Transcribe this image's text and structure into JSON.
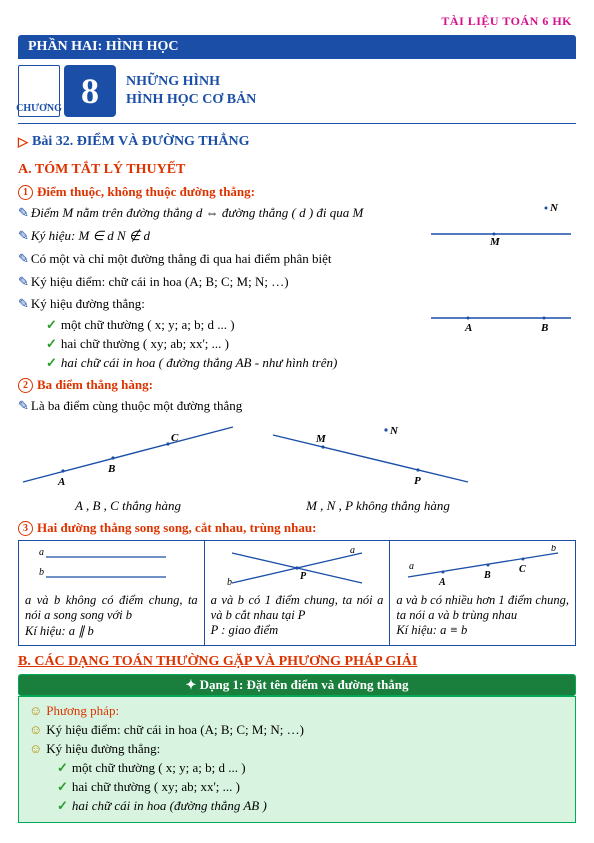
{
  "doc_badge": "TÀI LIỆU TOÁN 6 HK",
  "part_bar": "PHẦN HAI:  HÌNH HỌC",
  "chapter_label": "CHƯƠNG",
  "chapter_num": "8",
  "chapter_line1": "NHỮNG HÌNH",
  "chapter_line2": "HÌNH HỌC CƠ BẢN",
  "lesson_title": "Bài 32. ĐIỂM VÀ ĐƯỜNG THẲNG",
  "sec_a": "A. TÓM TẮT LÝ THUYẾT",
  "sub1_num": "1",
  "sub1_title": "Điểm thuộc, không thuộc đường thẳng:",
  "line1": "Điểm  M  nằm trên đường thẳng d  ⇔   đường thẳng ( d )  đi qua  M",
  "line2": "Ký hiệu:   M ∈ d                         N ∉ d",
  "line3": "Có một và chỉ một đường thẳng đi qua hai điểm phân biệt",
  "line4": "Ký hiệu điểm: chữ cái in hoa (A; B; C; M; N; …)",
  "line5": "Ký hiệu đường thẳng:",
  "chk1": "một chữ thường ( x; y; a; b; d ... )",
  "chk2": "hai chữ thường ( xy; ab; xx'; ... )",
  "chk3": "hai chữ cái in hoa ( đường thẳng  AB  - như hình trên)",
  "sub2_num": "2",
  "sub2_title": "Ba điểm thẳng hàng:",
  "line6": "Là ba điểm cùng thuộc một đường thẳng",
  "cap_left": "A , B , C   thẳng hàng",
  "cap_right": "M , N , P   không thẳng hàng",
  "sub3_num": "3",
  "sub3_title": "Hai đường thẳng song song, cắt nhau, trùng nhau:",
  "col1_t1": "a  và  b  không có điểm chung, ta nói a song song với b",
  "col1_t2": "Kí hiệu:  a ∥ b",
  "col2_t1": "a và b có 1 điểm chung, ta nói a và b cắt nhau tại  P",
  "col2_t2": "P : giao điểm",
  "col3_t1": "a và b có nhiều hơn 1 điểm chung, ta nói a  và  b trùng nhau",
  "col3_t2": "Kí hiệu:  a ≡ b",
  "sec_b": "B. CÁC DẠNG TOÁN THƯỜNG GẶP VÀ PHƯƠNG PHÁP GIẢI",
  "dang_bar": "✦ Dạng 1: Đặt tên điểm và đường thẳng",
  "method_title": "Phương pháp:",
  "m1": "Ký hiệu điểm: chữ cái in hoa (A; B; C; M; N; …)",
  "m2": "Ký hiệu đường thẳng:",
  "mc1": "một chữ thường ( x; y; a; b; d ... )",
  "mc2": "hai chữ thường ( xy; ab; xx'; ... )",
  "mc3": "hai chữ cái in hoa (đường thẳng  AB )"
}
